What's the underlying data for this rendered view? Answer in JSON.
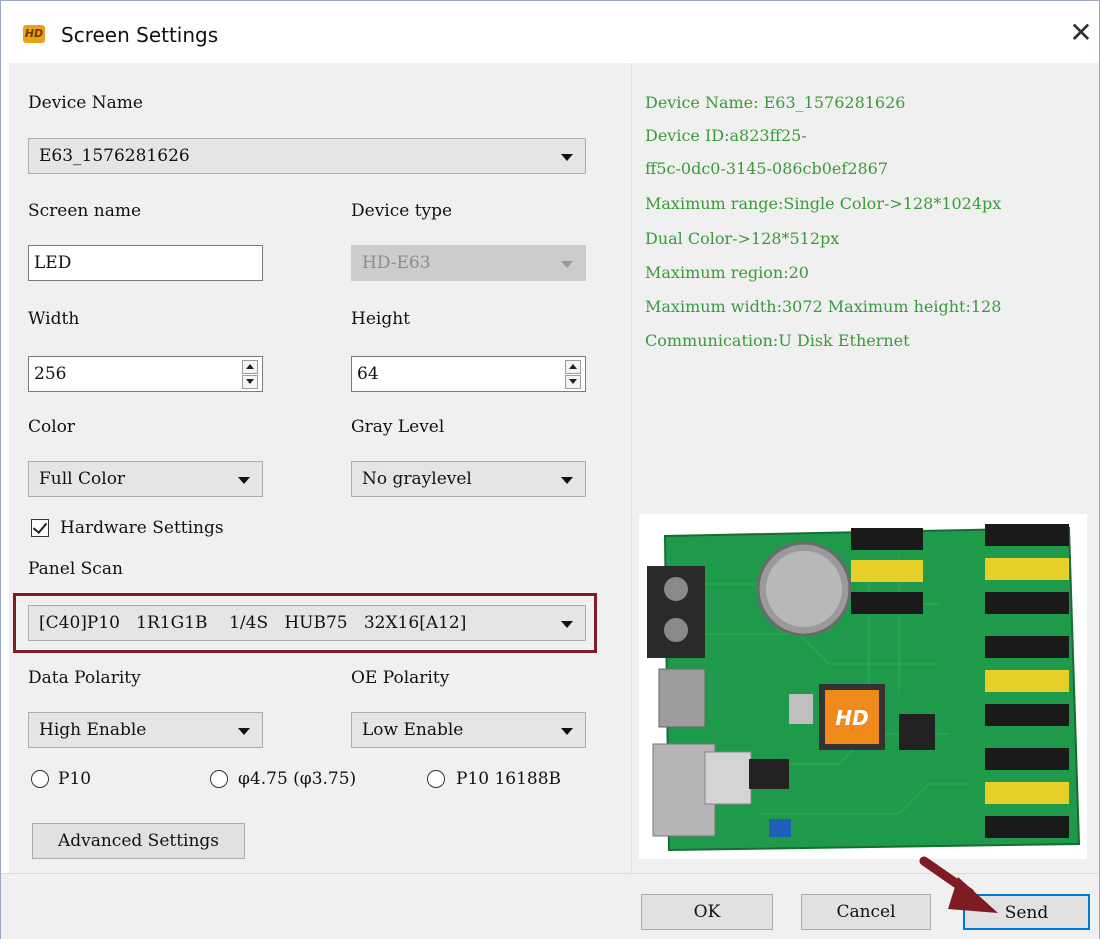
{
  "window": {
    "title": "Screen Settings",
    "app_icon_text": "HD",
    "close_glyph": "✕"
  },
  "form": {
    "device_name": {
      "label": "Device Name",
      "value": "E63_1576281626"
    },
    "screen_name": {
      "label": "Screen name",
      "value": "LED"
    },
    "device_type": {
      "label": "Device type",
      "value": "HD-E63"
    },
    "width": {
      "label": "Width",
      "value": "256"
    },
    "height": {
      "label": "Height",
      "value": "64"
    },
    "color": {
      "label": "Color",
      "value": "Full Color"
    },
    "gray_level": {
      "label": "Gray Level",
      "value": "No graylevel"
    },
    "hardware_settings": {
      "label": "Hardware Settings",
      "checked": true
    },
    "panel_scan": {
      "label": "Panel Scan",
      "value": "[C40]P10   1R1G1B    1/4S   HUB75   32X16[A12]"
    },
    "data_polarity": {
      "label": "Data Polarity",
      "value": "High Enable"
    },
    "oe_polarity": {
      "label": "OE Polarity",
      "value": "Low Enable"
    },
    "radios": [
      "P10",
      "φ4.75 (φ3.75)",
      "P10 16188B"
    ],
    "advanced_button": "Advanced Settings"
  },
  "info": {
    "lines": [
      "Device Name: E63_1576281626",
      "Device ID:a823ff25-",
      "ff5c-0dc0-3145-086cb0ef2867",
      "Maximum range:Single Color->128*1024px",
      "Dual Color->128*512px",
      "Maximum region:20",
      "Maximum width:3072 Maximum height:128",
      "Communication:U Disk  Ethernet"
    ],
    "board_chip_logo": "HD"
  },
  "footer": {
    "ok": "OK",
    "cancel": "Cancel",
    "send": "Send"
  },
  "colors": {
    "info_text": "#3a9a3a",
    "highlight": "#7e1b25",
    "arrow": "#7e1b25",
    "default_button_border": "#0078d7"
  }
}
